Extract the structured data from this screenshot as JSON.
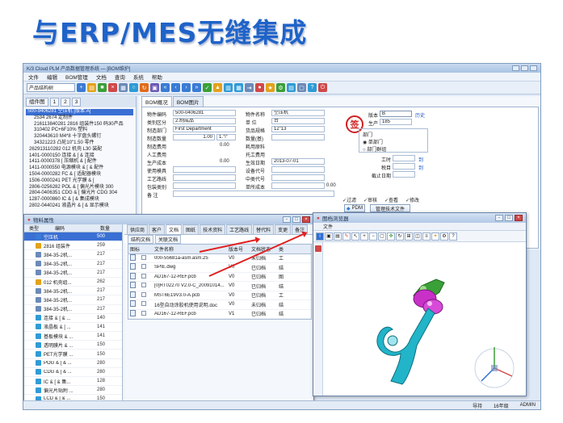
{
  "headline": "与ERP/MES无缝集成",
  "app": {
    "title": "K/3 Cloud PLM 产品数据管理系统 — [BOM维护]",
    "menu": [
      "文件",
      "编辑",
      "BOM管理",
      "文档",
      "查询",
      "系统",
      "帮助"
    ],
    "combo": "产品结构树",
    "left_tabs": [
      "组件图",
      "1",
      "2",
      "3"
    ],
    "tree": [
      "S00-9406281 空压机 [版本:A]",
      "2534 2674 定制件",
      "216113840281 2816 组装件150 码30产品",
      "310402 PC+6F10% 塑料",
      "320443610 M4*8 十字盘头螺钉",
      "34321223 凸轮10\"1.50 零件",
      "262913110282 012 机壳 L30 装配",
      "1401-0000150 连接 & [ & 连接",
      "1411-0000378 [ 压缩机 & [ 配件",
      "1411-0000550 电源模块 & [ & 配件",
      "1504-0000282 FC & [ 适配器模块",
      "1506-0000241 PET 光学膜 & [",
      "2806-0256282 POL & [ 偏光片模块 300",
      "2804-0406351 CDG & [ 偏光片 CDG 304",
      "1287-0000860 IC & [ & 集成模块",
      "2802-0440241 液晶片 & [ & 显示模块"
    ],
    "main_tabs": [
      "BOM概况",
      "BOM图片"
    ],
    "form": {
      "code_label": "物件编码",
      "code_value": "500-0406281",
      "name_label": "物件名称",
      "name_value": "空压机",
      "cat_label": "类别区分",
      "cat_value": "2.制成品",
      "unit_label": "单    位",
      "unit_value": "台",
      "dept_label": "制造部门",
      "dept_value": "First Department",
      "spec_label": "货品规格",
      "spec_value": "12\"13",
      "qty_label": "制造数量",
      "qty_value": "1.00",
      "qty_unit": "1.个",
      "qtyb_label": "数量(基)",
      "qtyb_value": "",
      "cost_label": "制造费用",
      "cost_value": "0.00",
      "mat_label": "耗用原料",
      "mat_value": "",
      "labor_label": "人工费用",
      "labor_value": "",
      "tooling_label": "托工费用",
      "tooling_value": "",
      "prodcost_label": "生产成本",
      "prodcost_value": "0.00",
      "date_label": "生效日期",
      "date_value": "2013-07-01",
      "mold_label": "使用模具",
      "mold_value": "",
      "equip_label": "设备代号",
      "equip_value": "",
      "route_label": "工艺路线",
      "route_value": "",
      "mid_label": "中类代号",
      "mid_value": "",
      "pkg_label": "包装类别",
      "pkg_value": "",
      "unitcost_label": "单所成本",
      "unitcost_value": "0.00",
      "remark_label": "备    注",
      "remark_value": "",
      "stamp": "签",
      "ver_label": "版本",
      "ver_value": "B",
      "ver_link": "历史",
      "gen_label": "生产",
      "gen_value": "185",
      "deptsel_label": "部门",
      "radio_single": "单部门",
      "radio_multi": "部门群组",
      "work_label": "工时",
      "work_link": "到",
      "vat_label": "税目",
      "vat_link": "到",
      "date2_label": "截止日期",
      "opt1": "过滤",
      "opt2": "审核",
      "opt3": "查看",
      "opt4": "修改",
      "pdm_btn": "PDM",
      "manage_btn": "管理技术文件"
    },
    "status": [
      "导持",
      "16年级",
      "ADMIN"
    ]
  },
  "win1": {
    "title": "物料属性",
    "head_col1": "类型",
    "head_col2": "编码",
    "head_col3": "数量",
    "tree_rows": [
      {
        "name": "空压机",
        "qty": "500"
      },
      {
        "name": "2816 组装件",
        "qty": "259"
      },
      {
        "name": "384-35-2机...",
        "qty": "217"
      },
      {
        "name": "384-35-2机...",
        "qty": "217"
      },
      {
        "name": "384-35-2机...",
        "qty": "217"
      },
      {
        "name": "012 机壳组...",
        "qty": "262"
      },
      {
        "name": "384-35-2机...",
        "qty": "217"
      },
      {
        "name": "384-35-2机...",
        "qty": "217"
      },
      {
        "name": "384-35-2机...",
        "qty": "217"
      },
      {
        "name": "连接 & [ & ...",
        "qty": "140"
      },
      {
        "name": "液晶板 & [ ...",
        "qty": "141"
      },
      {
        "name": "基板模块 & ...",
        "qty": "141"
      },
      {
        "name": "透明膜片 & ...",
        "qty": "150"
      },
      {
        "name": "PET光学膜 ...",
        "qty": "150"
      },
      {
        "name": "POG & [ & ...",
        "qty": "280"
      },
      {
        "name": "CDG & [ & ...",
        "qty": "280"
      },
      {
        "name": "IC & [ & 集...",
        "qty": "128"
      },
      {
        "name": "偏光片贴附 ...",
        "qty": "280"
      },
      {
        "name": "LCD & [ & ...",
        "qty": "150"
      },
      {
        "name": "POL & [ & ...",
        "qty": "280"
      }
    ],
    "tabs": [
      "供应商",
      "客户",
      "文档",
      "图纸",
      "技术资料",
      "工艺路线",
      "替代料",
      "变更",
      "备注"
    ],
    "sub_tabs": [
      "结构文档",
      "关联文档"
    ],
    "table_head": [
      "图标",
      "",
      "文件名称",
      "版本号",
      "文档状态",
      "类"
    ],
    "files": [
      {
        "name": "000-55681a-asm.asm.25",
        "ver": "V0",
        "state": "未归档",
        "cls": "工"
      },
      {
        "name": "SPIE.dwg",
        "ver": "V0",
        "state": "已归档",
        "cls": "结"
      },
      {
        "name": "AD167-12-REF.pcb",
        "ver": "V0",
        "state": "已归档",
        "cls": "图"
      },
      {
        "name": "[0]RT02270 V2.0-C_20091014...",
        "ver": "V0",
        "state": "已归档",
        "cls": "结"
      },
      {
        "name": "MST6E19V3.0-A.pcb",
        "ver": "V0",
        "state": "已归档",
        "cls": "工"
      },
      {
        "name": "16型自动涂胶机使用说明.doc",
        "ver": "V0",
        "state": "未归档",
        "cls": "结"
      },
      {
        "name": "AD167-12-REF.pcb",
        "ver": "V1",
        "state": "已归档",
        "cls": "结"
      }
    ]
  },
  "win2": {
    "title": "图档浏览器",
    "menu": "文件"
  },
  "colors": {
    "headline": "#1f63c9",
    "arrow": "#e02020",
    "selection": "#3a6fd3",
    "part_magenta": "#c830c8",
    "part_green": "#3aa038",
    "part_cyan": "#22b4c8"
  }
}
